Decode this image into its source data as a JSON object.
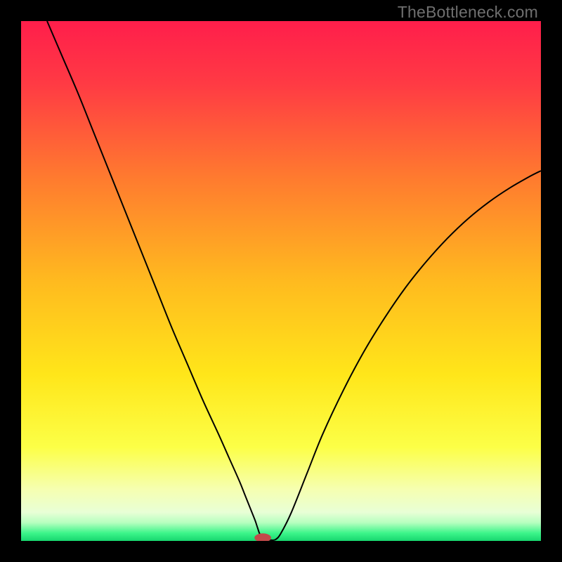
{
  "watermark": "TheBottleneck.com",
  "chart_data": {
    "type": "line",
    "title": "",
    "xlabel": "",
    "ylabel": "",
    "xlim": [
      0,
      100
    ],
    "ylim": [
      0,
      100
    ],
    "grid": false,
    "legend": false,
    "background_gradient_stops": [
      {
        "offset": 0.0,
        "color": "#ff1e4b"
      },
      {
        "offset": 0.12,
        "color": "#ff3a44"
      },
      {
        "offset": 0.3,
        "color": "#ff7a2f"
      },
      {
        "offset": 0.5,
        "color": "#ffba1f"
      },
      {
        "offset": 0.68,
        "color": "#ffe61a"
      },
      {
        "offset": 0.82,
        "color": "#fcff47"
      },
      {
        "offset": 0.9,
        "color": "#f6ffb0"
      },
      {
        "offset": 0.945,
        "color": "#e8ffd6"
      },
      {
        "offset": 0.965,
        "color": "#b6ffbf"
      },
      {
        "offset": 0.985,
        "color": "#3cf58a"
      },
      {
        "offset": 1.0,
        "color": "#17d66e"
      }
    ],
    "series": [
      {
        "name": "bottleneck-curve",
        "stroke": "#000000",
        "stroke_width": 2,
        "x": [
          5,
          8,
          11,
          14,
          17,
          20,
          23,
          26,
          29,
          32,
          35,
          38,
          40,
          42,
          43,
          44,
          45,
          45.5,
          46,
          47,
          48,
          49,
          50,
          52,
          55,
          58,
          62,
          66,
          70,
          74,
          78,
          82,
          86,
          90,
          94,
          98,
          100
        ],
        "y": [
          100,
          93,
          86,
          78.5,
          71,
          63.5,
          56,
          48.5,
          41,
          34,
          27,
          20.5,
          16,
          11.5,
          9,
          6.5,
          4,
          2.5,
          1.2,
          0.3,
          0.15,
          0.3,
          1.5,
          5.5,
          13,
          20.5,
          29,
          36.5,
          43,
          48.8,
          53.8,
          58.2,
          62,
          65.2,
          67.9,
          70.2,
          71.2
        ]
      }
    ],
    "marker": {
      "name": "bottleneck-point",
      "x": 46.5,
      "y": 0.6,
      "rx": 1.6,
      "ry": 0.85,
      "fill": "#c24a4a"
    }
  }
}
